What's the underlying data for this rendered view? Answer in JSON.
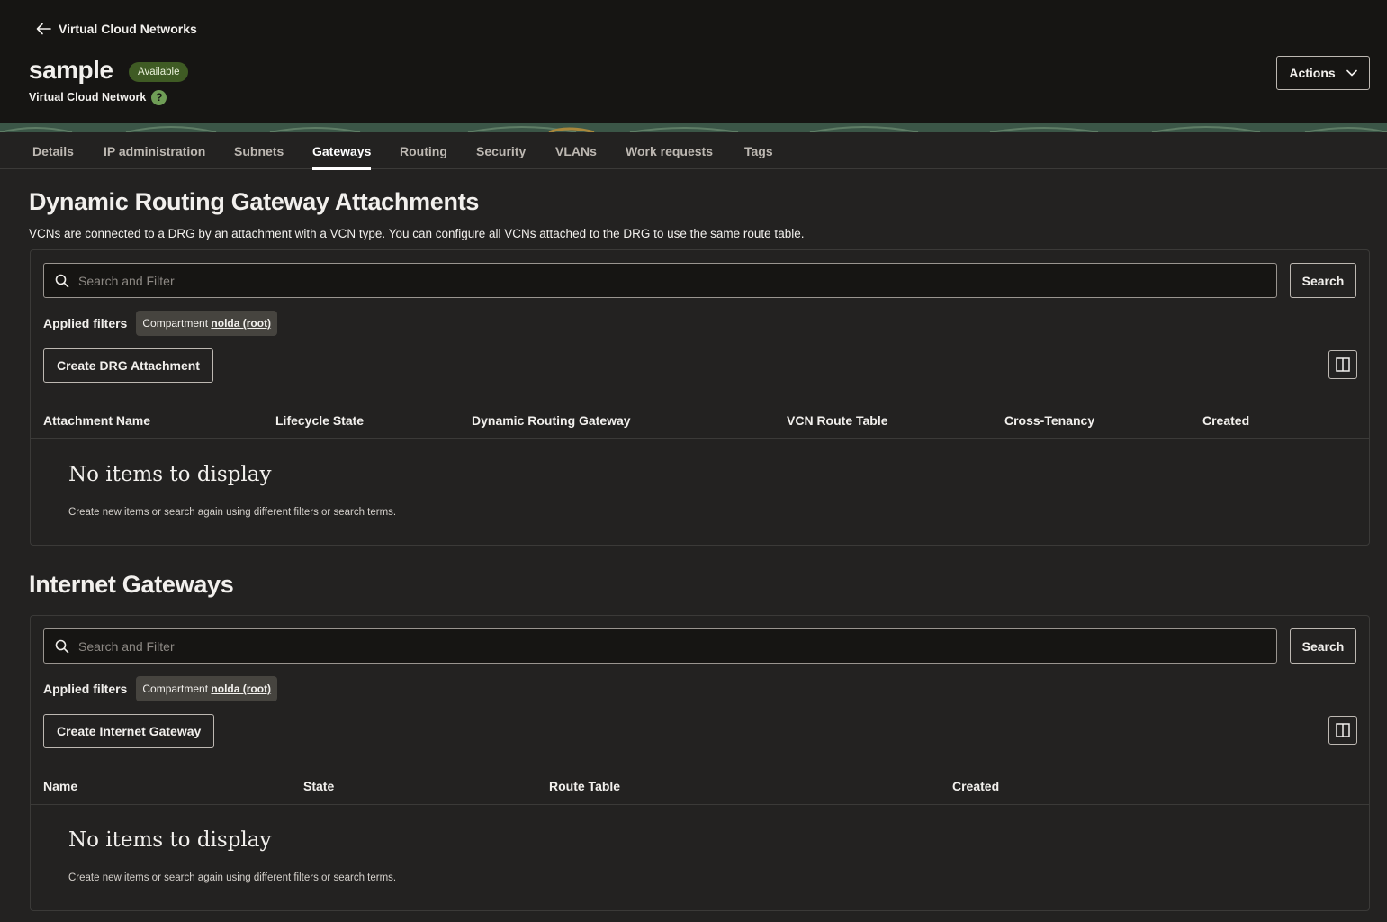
{
  "header": {
    "back_label": "Virtual Cloud Networks",
    "title": "sample",
    "status": "Available",
    "subtitle": "Virtual Cloud Network",
    "help_glyph": "?",
    "actions_label": "Actions"
  },
  "tabs": [
    {
      "label": "Details"
    },
    {
      "label": "IP administration"
    },
    {
      "label": "Subnets"
    },
    {
      "label": "Gateways",
      "active": true
    },
    {
      "label": "Routing"
    },
    {
      "label": "Security"
    },
    {
      "label": "VLANs"
    },
    {
      "label": "Work requests"
    },
    {
      "label": "Tags"
    }
  ],
  "drg": {
    "title": "Dynamic Routing Gateway Attachments",
    "description": "VCNs are connected to a DRG by an attachment with a VCN type. You can configure all VCNs attached to the DRG to use the same route table.",
    "search_placeholder": "Search and Filter",
    "search_button": "Search",
    "filters_label": "Applied filters",
    "filter_key": "Compartment",
    "filter_value": "nolda (root)",
    "create_button": "Create DRG Attachment",
    "columns": [
      "Attachment Name",
      "Lifecycle State",
      "Dynamic Routing Gateway",
      "VCN Route Table",
      "Cross-Tenancy",
      "Created"
    ],
    "empty_title": "No items to display",
    "empty_desc": "Create new items or search again using different filters or search terms."
  },
  "igw": {
    "title": "Internet Gateways",
    "search_placeholder": "Search and Filter",
    "search_button": "Search",
    "filters_label": "Applied filters",
    "filter_key": "Compartment",
    "filter_value": "nolda (root)",
    "create_button": "Create Internet Gateway",
    "columns": [
      "Name",
      "State",
      "Route Table",
      "Created"
    ],
    "empty_title": "No items to display",
    "empty_desc": "Create new items or search again using different filters or search terms."
  },
  "colors": {
    "background": "#232221",
    "header_bg": "#161513",
    "status_badge": "#3f5b24",
    "help_icon": "#6f9d56"
  }
}
